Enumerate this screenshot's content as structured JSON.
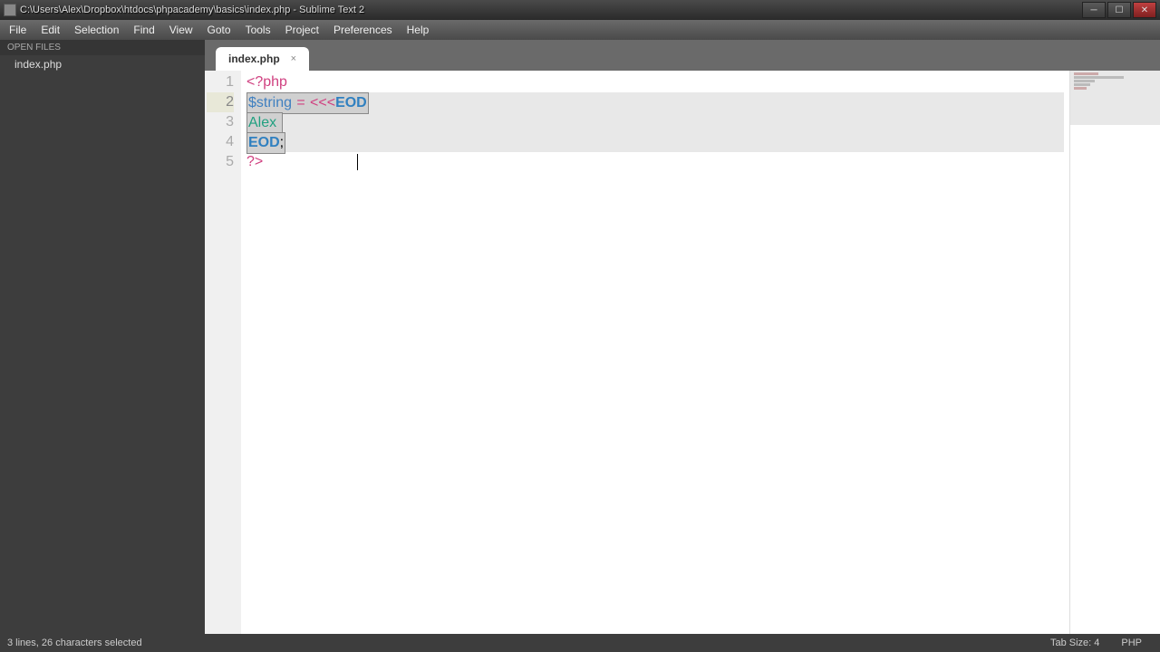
{
  "window": {
    "title": "C:\\Users\\Alex\\Dropbox\\htdocs\\phpacademy\\basics\\index.php - Sublime Text 2"
  },
  "menu": {
    "items": [
      "File",
      "Edit",
      "Selection",
      "Find",
      "View",
      "Goto",
      "Tools",
      "Project",
      "Preferences",
      "Help"
    ]
  },
  "sidebar": {
    "header": "OPEN FILES",
    "items": [
      "index.php"
    ]
  },
  "tabs": [
    {
      "title": "index.php"
    }
  ],
  "code": {
    "lines": [
      {
        "num": "1",
        "raw": "<?php"
      },
      {
        "num": "2",
        "raw": "$string = <<<EOD"
      },
      {
        "num": "3",
        "raw": "Alex"
      },
      {
        "num": "4",
        "raw": "EOD;"
      },
      {
        "num": "5",
        "raw": "?>"
      }
    ],
    "tokens": {
      "l1_open": "<?php",
      "l2_var": "$string",
      "l2_dot1": "·",
      "l2_eq": "=",
      "l2_dot2": "·",
      "l2_heredoc": "<<<",
      "l2_eod": "EOD",
      "l3_text": "Alex",
      "l4_eod": "EOD",
      "l4_semi": ";",
      "l5_close": "?>"
    }
  },
  "status": {
    "left": "3 lines, 26 characters selected",
    "tabsize": "Tab Size: 4",
    "lang": "PHP"
  }
}
